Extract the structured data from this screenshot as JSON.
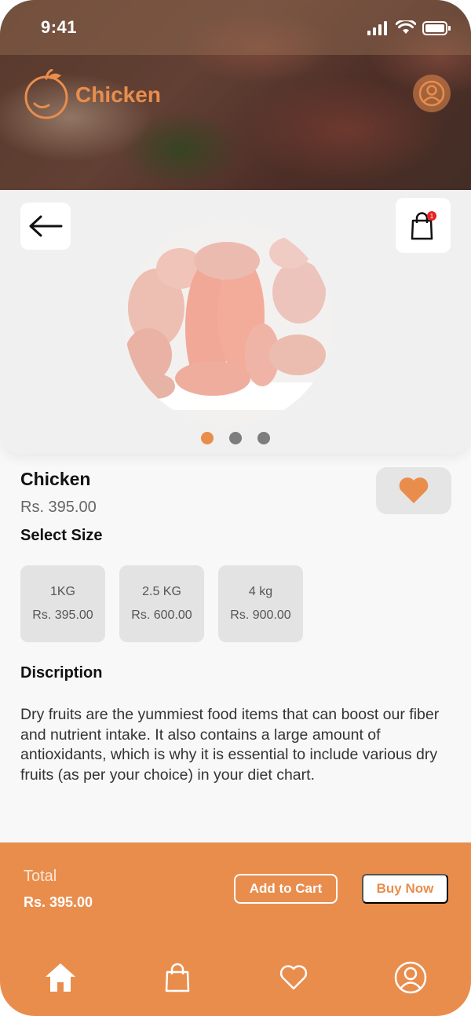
{
  "status_bar": {
    "time": "9:41"
  },
  "header": {
    "brand_name": "Chicken"
  },
  "product": {
    "title": "Chicken",
    "price": "Rs. 395.00",
    "carousel_active_index": 0,
    "carousel_count": 3,
    "cart_badge": "1"
  },
  "size_section": {
    "label": "Select Size",
    "options": [
      {
        "size": "1KG",
        "price": "Rs. 395.00"
      },
      {
        "size": "2.5 KG",
        "price": "Rs. 600.00"
      },
      {
        "size": "4 kg",
        "price": "Rs. 900.00"
      }
    ]
  },
  "description_section": {
    "label": "Discription",
    "text": "Dry fruits are the yummiest food items that can boost our fiber and nutrient intake. It also contains a large amount of antioxidants, which is why it is essential to include various dry fruits (as per your choice) in your diet chart."
  },
  "footer": {
    "total_label": "Total",
    "total_value": "Rs. 395.00",
    "add_to_cart_label": "Add to Cart",
    "buy_now_label": "Buy Now"
  },
  "bottom_nav": {
    "items": [
      {
        "icon": "home-icon"
      },
      {
        "icon": "bag-icon"
      },
      {
        "icon": "heart-icon"
      },
      {
        "icon": "profile-icon"
      }
    ]
  },
  "colors": {
    "accent": "#e98d4d",
    "card_background": "#f0f0f0",
    "chip_background": "#e3e3e3"
  }
}
